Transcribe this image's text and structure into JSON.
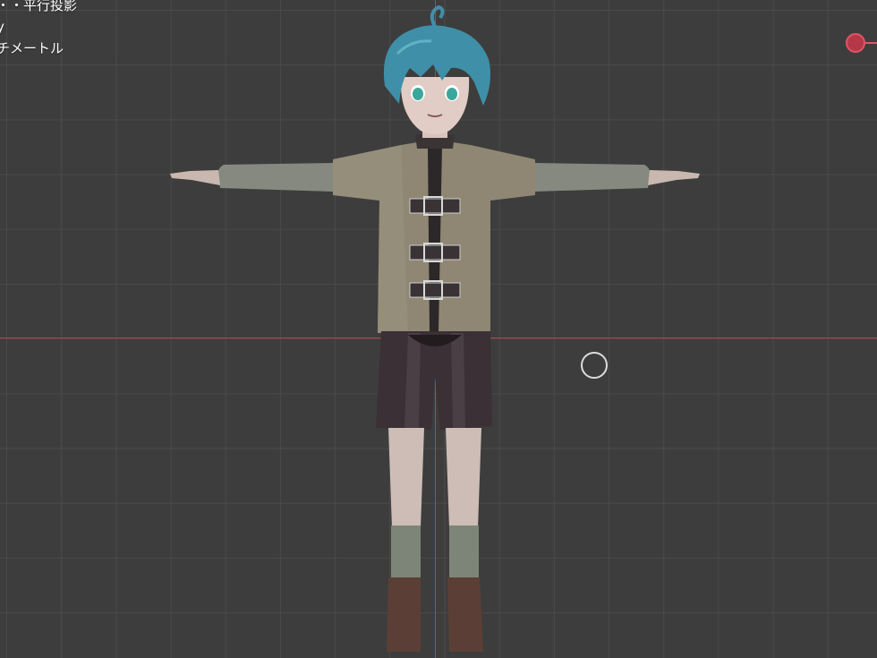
{
  "viewport": {
    "overlay_lines": [
      "・・平行投影",
      "y",
      "チメートル"
    ]
  },
  "colors": {
    "background": "#3d3d3d",
    "grid_line": "#4a4a4a",
    "x_axis": "#b8404e",
    "z_axis": "#3b6fa8",
    "gizmo_x": "#e05565",
    "hair": "#3f8fa8",
    "jacket": "#8f8774",
    "shorts": "#3a3035",
    "socks": "#7c8577",
    "boots": "#5b3f36"
  },
  "icons": {
    "gizmo": "axis-x-gizmo-icon",
    "cursor": "3d-cursor-icon"
  }
}
